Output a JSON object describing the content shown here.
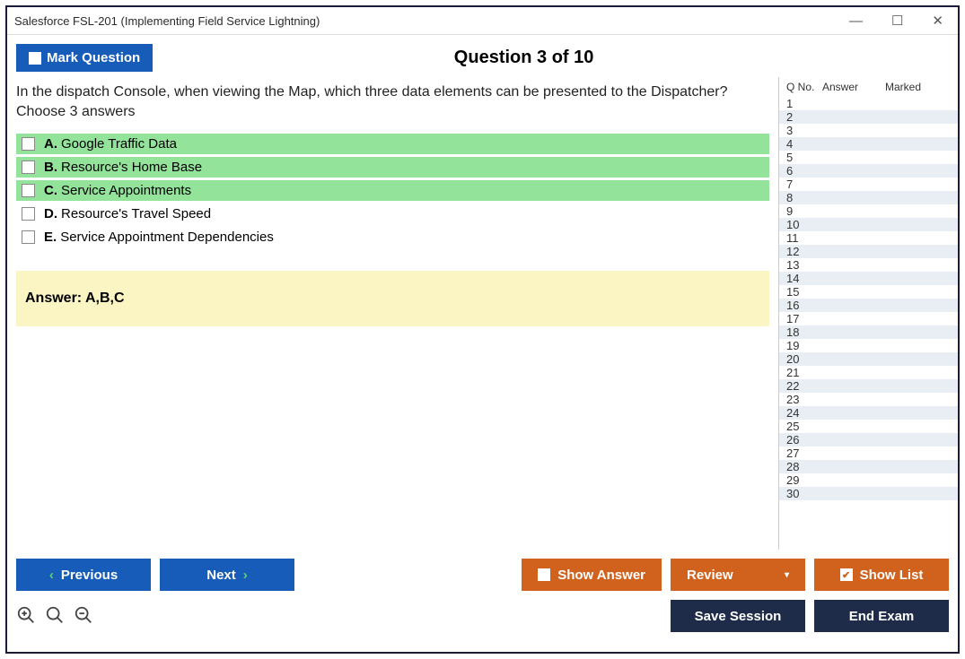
{
  "window": {
    "title": "Salesforce FSL-201 (Implementing Field Service Lightning)"
  },
  "topbar": {
    "mark_label": "Mark Question",
    "counter": "Question 3 of 10"
  },
  "question": {
    "text": "In the dispatch Console, when viewing the Map, which three data elements can be presented to the Dispatcher? Choose 3 answers",
    "options": [
      {
        "letter": "A.",
        "text": "Google Traffic Data",
        "correct": true
      },
      {
        "letter": "B.",
        "text": "Resource's Home Base",
        "correct": true
      },
      {
        "letter": "C.",
        "text": "Service Appointments",
        "correct": true
      },
      {
        "letter": "D.",
        "text": "Resource's Travel Speed",
        "correct": false
      },
      {
        "letter": "E.",
        "text": "Service Appointment Dependencies",
        "correct": false
      }
    ],
    "answer_label": "Answer: A,B,C"
  },
  "sidebar": {
    "headers": {
      "qno": "Q No.",
      "answer": "Answer",
      "marked": "Marked"
    },
    "rows": [
      1,
      2,
      3,
      4,
      5,
      6,
      7,
      8,
      9,
      10,
      11,
      12,
      13,
      14,
      15,
      16,
      17,
      18,
      19,
      20,
      21,
      22,
      23,
      24,
      25,
      26,
      27,
      28,
      29,
      30
    ]
  },
  "footer": {
    "previous": "Previous",
    "next": "Next",
    "show_answer": "Show Answer",
    "review": "Review",
    "show_list": "Show List",
    "save_session": "Save Session",
    "end_exam": "End Exam"
  }
}
